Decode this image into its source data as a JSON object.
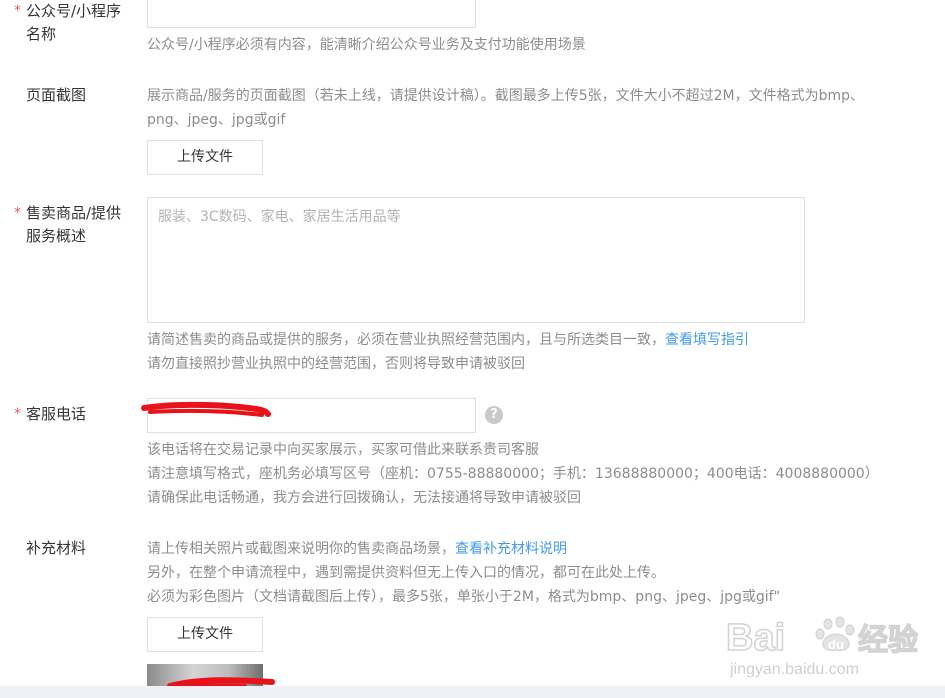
{
  "fields": {
    "account_name": {
      "label_line1": "公众号/小程序",
      "label_line2": "名称",
      "hint": "公众号/小程序必须有内容，能清晰介绍公众号业务及支付功能使用场景"
    },
    "screenshot": {
      "label": "页面截图",
      "hint_line1": "展示商品/服务的页面截图（若未上线，请提供设计稿）。截图最多上传5张，文件大小不超过2M，文件格式为bmp、",
      "hint_line2": "png、jpeg、jpg或gif",
      "upload_label": "上传文件"
    },
    "goods": {
      "label_line1": "售卖商品/提供",
      "label_line2": "服务概述",
      "placeholder": "服装、3C数码、家电、家居生活用品等",
      "hint_line1": "请简述售卖的商品或提供的服务，必须在营业执照经营范围内，且与所选类目一致，",
      "hint_link": "查看填写指引",
      "hint_line2": "请勿直接照抄营业执照中的经营范围，否则将导致申请被驳回"
    },
    "phone": {
      "label": "客服电话",
      "help_glyph": "?",
      "hint_line1": "该电话将在交易记录中向买家展示，买家可借此来联系贵司客服",
      "hint_line2": "请注意填写格式，座机务必填写区号（座机：0755-88880000；手机：13688880000；400电话：4008880000）",
      "hint_line3": "请确保此电话畅通，我方会进行回拨确认，无法接通将导致申请被驳回"
    },
    "extra": {
      "label": "补充材料",
      "hint_line1": "请上传相关照片或截图来说明你的售卖商品场景，",
      "hint_link": "查看补充材料说明",
      "hint_line2": "另外，在整个申请流程中，遇到需提供资料但无上传入口的情况，都可在此处上传。",
      "hint_line3": "必须为彩色图片（文档请截图后上传），最多5张，单张小于2M，格式为bmp、png、jpeg、jpg或gif\"",
      "upload_label": "上传文件"
    }
  },
  "required_mark": "*",
  "watermark": {
    "brand": "Bai",
    "brand_suffix": "经验",
    "url": "jingyan.baidu.com"
  },
  "colors": {
    "required": "#e15f63",
    "link": "#459ae9",
    "hint": "#8d8d8d",
    "redaction": "#e8131a"
  }
}
